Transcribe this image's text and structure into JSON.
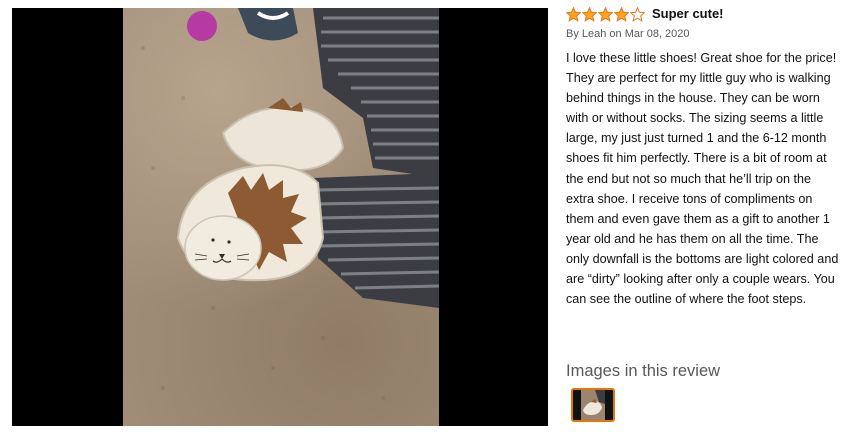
{
  "review": {
    "rating": 4,
    "max_rating": 5,
    "title": "Super cute!",
    "byline": "By Leah on Mar 08, 2020",
    "body": "I love these little shoes! Great shoe for the price! They are perfect for my little guy who is walking behind things in the house. They can be worn with or without socks. The sizing seems a little large, my just just turned 1 and the 6-12 month shoes fit him perfectly. There is a bit of room at the end but not so much that he’ll trip on the extra shoe. I receive tons of compliments on them and even gave them as a gift to another 1 year old and he has them on all the time. The only downfall is the bottoms are light colored and are “dirty” looking after only a couple wears. You can see the outline of where the foot steps.",
    "images_heading": "Images in this review"
  },
  "colors": {
    "star": "#ffa41c",
    "star_outline": "#de7921",
    "thumb_border": "#e77600"
  }
}
